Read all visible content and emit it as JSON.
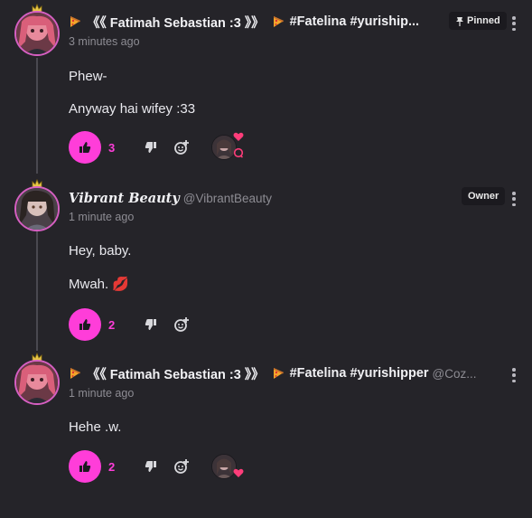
{
  "comments": [
    {
      "author_pizza_icon": "pizza-icon",
      "author": "《《 Fatimah Sebastian :3 》》",
      "tag_pizza_icon": "pizza-icon",
      "tag": "#Fatelina #yuriship...",
      "handle": "",
      "time": "3 minutes ago",
      "badge": "Pinned",
      "badge_icon": "pin-icon",
      "lines": [
        "Phew-",
        "Anyway hai wifey :33"
      ],
      "likes": "3",
      "reactions": [
        "heart-icon",
        "comment-icon"
      ]
    },
    {
      "author": "𝑽𝒊𝒃𝒓𝒂𝒏𝒕 𝑩𝒆𝒂𝒖𝒕𝒚",
      "handle": "@VibrantBeauty",
      "time": "1 minute ago",
      "badge": "Owner",
      "lines": [
        "Hey, baby.",
        "Mwah. 💋"
      ],
      "likes": "2"
    },
    {
      "author_pizza_icon": "pizza-icon",
      "author": "《《 Fatimah Sebastian :3 》》",
      "tag_pizza_icon": "pizza-icon",
      "tag": "#Fatelina #yurishipper",
      "handle": "@Coz...",
      "time": "1 minute ago",
      "lines": [
        "Hehe .w."
      ],
      "likes": "2",
      "reactions": [
        "heart-icon"
      ]
    }
  ],
  "colors": {
    "background": "#252429",
    "accent": "#ff3dd9",
    "muted": "#8d8c93",
    "avatar_ring": "#d65fc2"
  }
}
